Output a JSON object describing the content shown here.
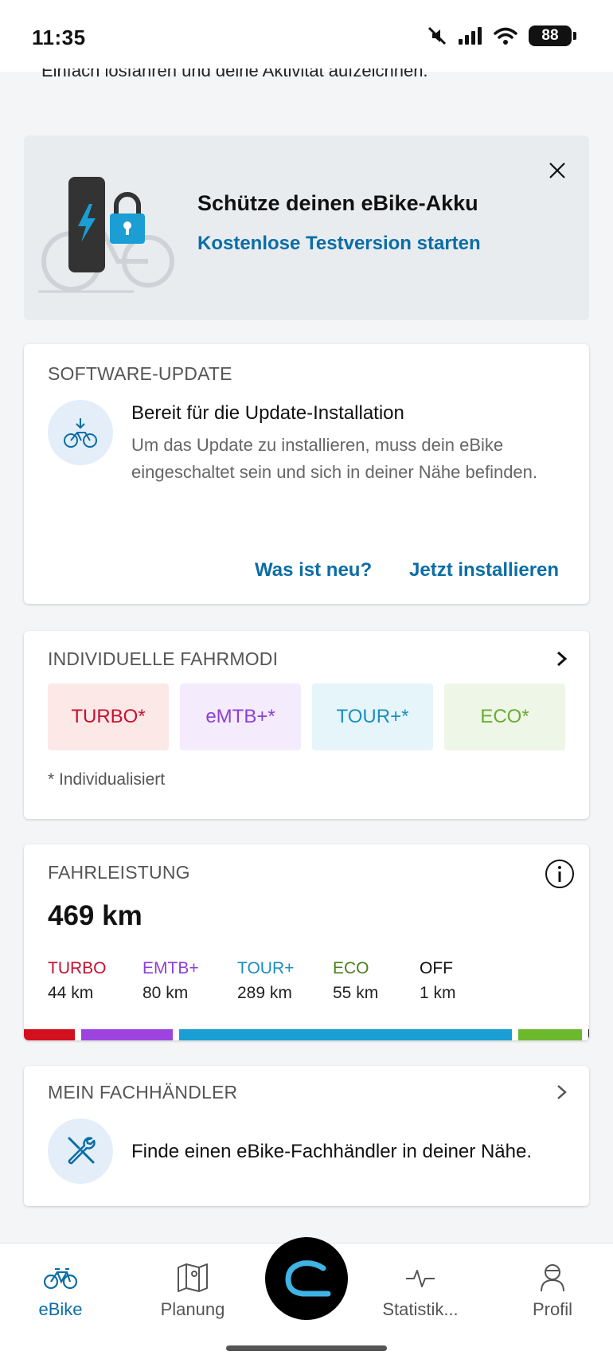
{
  "status": {
    "time": "11:35",
    "battery": "88"
  },
  "scroll_hint": "Einfach losfahren und deine Aktivität aufzeichnen.",
  "promo": {
    "title": "Schütze deinen eBike-Akku",
    "link": "Kostenlose Testversion starten"
  },
  "software_update": {
    "section_title": "SOFTWARE-UPDATE",
    "heading": "Bereit für die Update-Installation",
    "description": "Um das Update zu installieren, muss dein eBike eingeschaltet sein und sich in deiner Nähe befinden.",
    "whats_new": "Was ist neu?",
    "install": "Jetzt installieren"
  },
  "riding_modes": {
    "section_title": "INDIVIDUELLE FAHRMODI",
    "footnote": "* Individualisiert",
    "modes": [
      {
        "label": "TURBO*",
        "color": "#c8102e",
        "bg": "#fde8e8"
      },
      {
        "label": "eMTB+*",
        "color": "#8e3fd4",
        "bg": "#f4ecfc"
      },
      {
        "label": "TOUR+*",
        "color": "#1b8fc0",
        "bg": "#e6f5fa"
      },
      {
        "label": "ECO*",
        "color": "#6bab34",
        "bg": "#eef6e7"
      }
    ]
  },
  "performance": {
    "section_title": "FAHRLEISTUNG",
    "total": "469 km",
    "stats": [
      {
        "label": "TURBO",
        "value": "44 km",
        "color": "#c8102e",
        "km": 44
      },
      {
        "label": "EMTB+",
        "value": "80 km",
        "color": "#8e3fd4",
        "km": 80
      },
      {
        "label": "TOUR+",
        "value": "289 km",
        "color": "#1b8fc0",
        "km": 289
      },
      {
        "label": "ECO",
        "value": "55 km",
        "color": "#4d7f1e",
        "km": 55
      },
      {
        "label": "OFF",
        "value": "1 km",
        "color": "#111111",
        "km": 1
      }
    ],
    "bar_colors": [
      "#d2101e",
      "#9b44e0",
      "#1a9ed4",
      "#6cb92e",
      "#222222"
    ]
  },
  "dealer": {
    "section_title": "MEIN FACHHÄNDLER",
    "text": "Finde einen eBike-Fachhändler in deiner Nähe."
  },
  "nav": {
    "ebike": "eBike",
    "planning": "Planung",
    "statistics": "Statistik...",
    "profile": "Profil"
  },
  "accent_color": "#0b6da6"
}
